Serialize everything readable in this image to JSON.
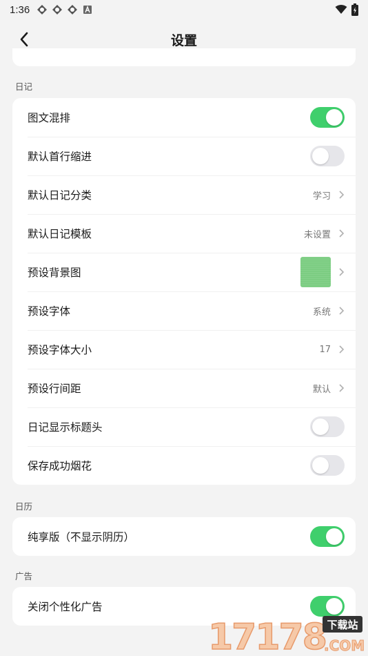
{
  "status_bar": {
    "time": "1:36",
    "notif_icons": [
      "app-notification-icon",
      "app-notification-icon",
      "app-notification-icon",
      "a-notification-icon"
    ],
    "right_icons": [
      "wifi-icon",
      "battery-icon"
    ]
  },
  "header": {
    "title": "设置",
    "back_icon": "back-arrow-icon"
  },
  "sections": {
    "diary": {
      "title": "日记",
      "rows": {
        "mixed_layout": {
          "label": "图文混排",
          "toggle": true
        },
        "indent": {
          "label": "默认首行缩进",
          "toggle": false
        },
        "category": {
          "label": "默认日记分类",
          "value": "学习"
        },
        "template": {
          "label": "默认日记模板",
          "value": "未设置"
        },
        "background": {
          "label": "预设背景图",
          "thumb_color": "#7ccd82"
        },
        "font": {
          "label": "预设字体",
          "value": "系统"
        },
        "font_size": {
          "label": "预设字体大小",
          "value": "17"
        },
        "line_spacing": {
          "label": "预设行间距",
          "value": "默认"
        },
        "title_header": {
          "label": "日记显示标题头",
          "toggle": false
        },
        "fireworks": {
          "label": "保存成功烟花",
          "toggle": false
        }
      }
    },
    "calendar": {
      "title": "日历",
      "rows": {
        "pure": {
          "label": "纯享版（不显示阴历）",
          "toggle": true
        }
      }
    },
    "ads": {
      "title": "广告",
      "rows": {
        "personalized": {
          "label": "关闭个性化广告",
          "toggle": true
        }
      }
    }
  },
  "watermark": {
    "site_text": "17178",
    "badge_text": "下载站",
    "suffix": ".COM"
  },
  "colors": {
    "accent_green": "#3fcf6c",
    "background": "#f3f3f3",
    "card": "#ffffff"
  }
}
